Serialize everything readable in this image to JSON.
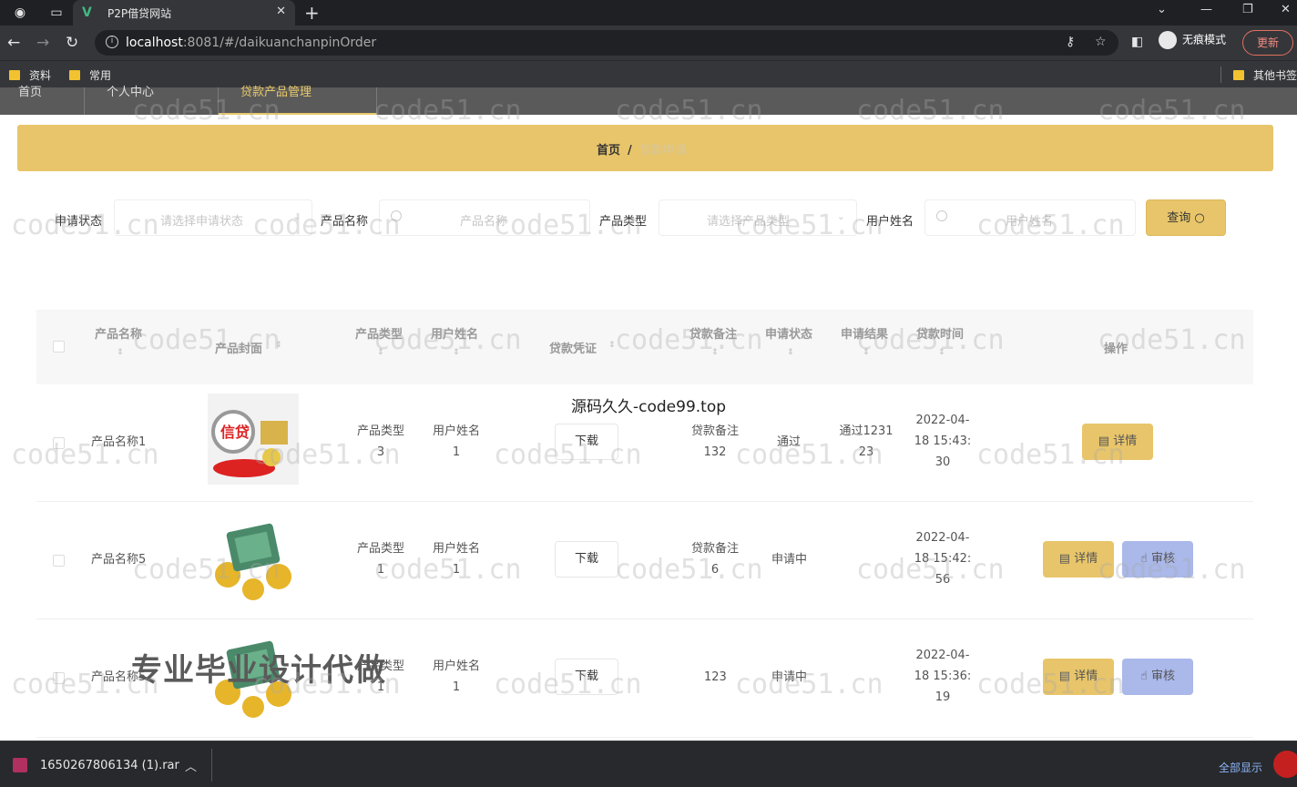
{
  "browser": {
    "tab_title": "P2P借贷网站",
    "url_host": "localhost",
    "url_rest": ":8081/#/daikuanchanpinOrder",
    "incognito_label": "无痕模式",
    "update_label": "更新",
    "bookmarks": [
      "资料",
      "常用"
    ],
    "other_bookmarks": "其他书签"
  },
  "app_nav": {
    "items": [
      "首页",
      "个人中心",
      "贷款产品管理"
    ]
  },
  "breadcrumb": {
    "home": "首页",
    "separator": "/",
    "current": "贷款申请"
  },
  "search": {
    "status_label": "申请状态",
    "status_placeholder": "请选择申请状态",
    "product_label": "产品名称",
    "product_placeholder": "产品名称",
    "type_label": "产品类型",
    "type_placeholder": "请选择产品类型",
    "user_label": "用户姓名",
    "user_placeholder": "用户姓名",
    "query_label": "查询"
  },
  "table": {
    "headers": {
      "name": "产品名称",
      "cover": "产品封面",
      "type": "产品类型",
      "user": "用户姓名",
      "voucher": "贷款凭证",
      "remark": "贷款备注",
      "status": "申请状态",
      "result": "申请结果",
      "time": "贷款时间",
      "ops": "操作"
    },
    "rows": [
      {
        "name": "产品名称1",
        "type": "产品类型3",
        "type1": "产品类型",
        "type2": "3",
        "user1": "用户姓名",
        "user2": "1",
        "download": "下载",
        "remark1": "贷款备注",
        "remark2": "132",
        "status": "通过",
        "result1": "通过1231",
        "result2": "23",
        "time1": "2022-04-",
        "time2": "18 15:43:",
        "time3": "30",
        "detail": "详情"
      },
      {
        "name": "产品名称5",
        "type1": "产品类型",
        "type2": "1",
        "user1": "用户姓名",
        "user2": "1",
        "download": "下载",
        "remark1": "贷款备注",
        "remark2": "6",
        "status": "申请中",
        "result1": "",
        "result2": "",
        "time1": "2022-04-",
        "time2": "18 15:42:",
        "time3": "56",
        "detail": "详情",
        "audit": "审核"
      },
      {
        "name": "产品名称5",
        "type1": "产品类型",
        "type2": "1",
        "user1": "用户姓名",
        "user2": "1",
        "download": "下载",
        "remark1": "123",
        "remark2": "",
        "status": "申请中",
        "result1": "",
        "result2": "",
        "time1": "2022-04-",
        "time2": "18 15:36:",
        "time3": "19",
        "detail": "详情",
        "audit": "审核"
      }
    ]
  },
  "overlays": {
    "top": "源码久久-code99.top",
    "big": "专业毕业设计代做",
    "watermark": "code51.cn"
  },
  "download_bar": {
    "file": "1650267806134 (1).rar",
    "show_all": "全部显示"
  }
}
